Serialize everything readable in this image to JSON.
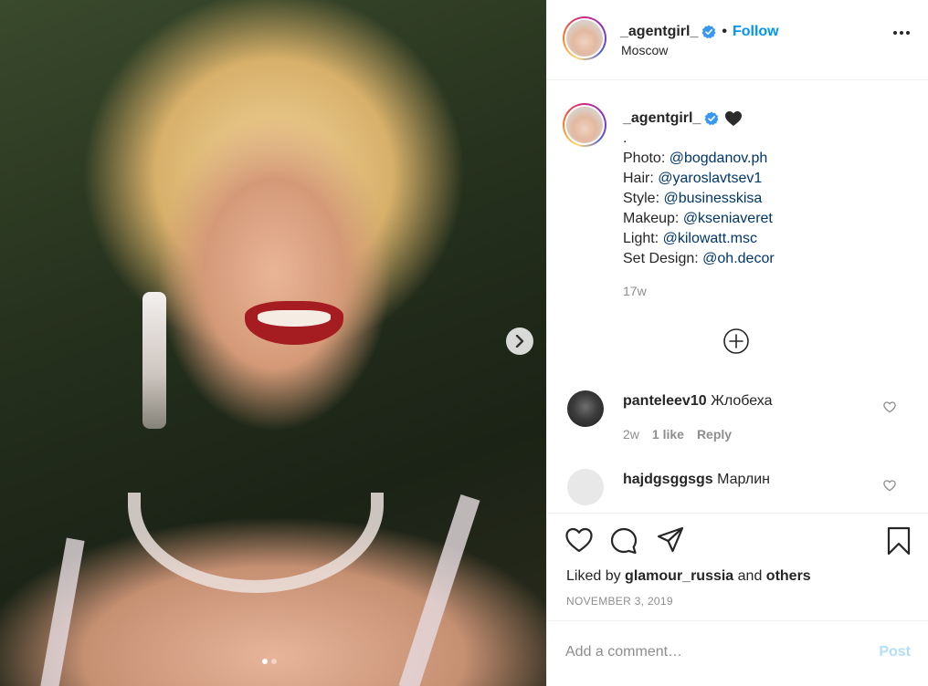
{
  "post": {
    "carousel": {
      "slide_count": 2,
      "active_slide": 1
    },
    "header": {
      "username": "_agentgirl_",
      "separator": "•",
      "follow_label": "Follow",
      "location": "Moscow"
    },
    "caption": {
      "username": "_agentgirl_",
      "lines": [
        {
          "prefix": ".",
          "mention": ""
        },
        {
          "prefix": "Photo: ",
          "mention": "@bogdanov.ph"
        },
        {
          "prefix": "Hair: ",
          "mention": "@yaroslavtsev1"
        },
        {
          "prefix": "Style: ",
          "mention": "@businesskisa"
        },
        {
          "prefix": "Makeup: ",
          "mention": "@kseniaveret"
        },
        {
          "prefix": "Light: ",
          "mention": "@kilowatt.msc"
        },
        {
          "prefix": "Set Design: ",
          "mention": "@oh.decor"
        }
      ],
      "time": "17w"
    },
    "comments": [
      {
        "username": "panteleev10",
        "text": "Жлобеха",
        "age": "2w",
        "likes": "1 like",
        "reply": "Reply"
      },
      {
        "username": "hajdgsggsgs",
        "text": "Марлин"
      }
    ],
    "likes": {
      "prefix": "Liked by ",
      "user": "glamour_russia",
      "middle": " and ",
      "others": "others"
    },
    "date": "November 3, 2019",
    "comment_box": {
      "placeholder": "Add a comment…",
      "post_label": "Post"
    },
    "colors": {
      "accent": "#0095f6",
      "mention": "#00376b",
      "post_disabled": "#b2dffc",
      "muted": "#8e8e8e"
    }
  }
}
